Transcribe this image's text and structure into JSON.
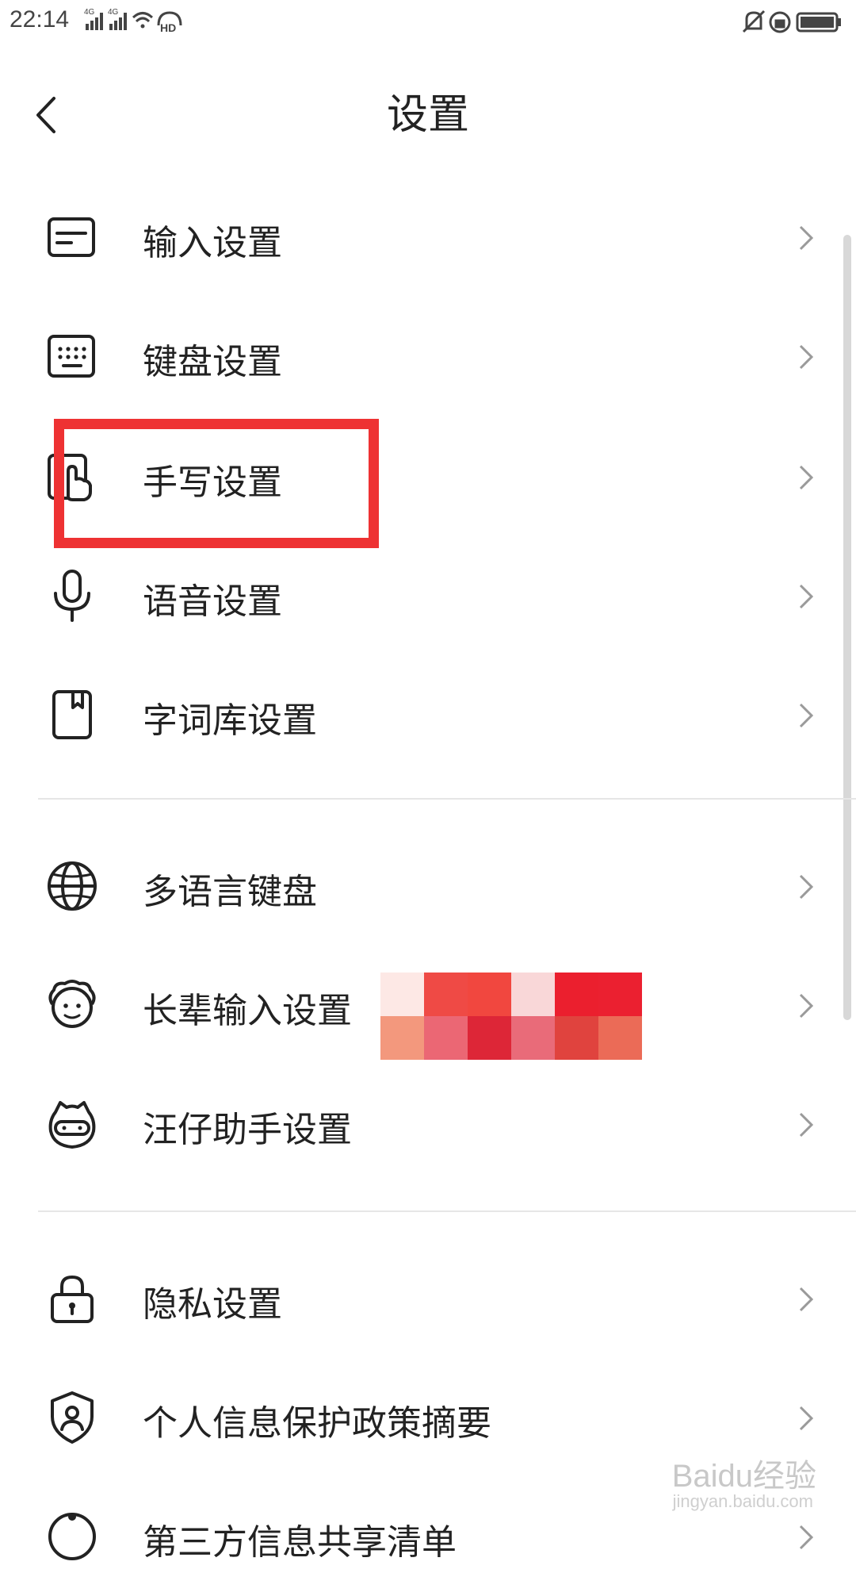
{
  "status_bar": {
    "time": "22:14",
    "signal_1": "4G",
    "signal_2": "4G",
    "hd_label": "HD"
  },
  "header": {
    "title": "设置"
  },
  "items": [
    {
      "label": "输入设置",
      "icon": "input-settings-icon"
    },
    {
      "label": "键盘设置",
      "icon": "keyboard-icon"
    },
    {
      "label": "手写设置",
      "icon": "handwriting-icon"
    },
    {
      "label": "语音设置",
      "icon": "microphone-icon"
    },
    {
      "label": "字词库设置",
      "icon": "dictionary-icon"
    },
    {
      "label": "多语言键盘",
      "icon": "globe-icon"
    },
    {
      "label": "长辈输入设置",
      "icon": "elder-icon"
    },
    {
      "label": "汪仔助手设置",
      "icon": "assistant-icon"
    },
    {
      "label": "隐私设置",
      "icon": "lock-icon"
    },
    {
      "label": "个人信息保护政策摘要",
      "icon": "shield-user-icon"
    },
    {
      "label": "第三方信息共享清单",
      "icon": "share-icon"
    }
  ],
  "watermark": {
    "text": "Baidu经验",
    "sub": "jingyan.baidu.com"
  },
  "colors": {
    "highlight": "#ee3233",
    "text": "#222222",
    "divider": "#e6e6e6"
  }
}
